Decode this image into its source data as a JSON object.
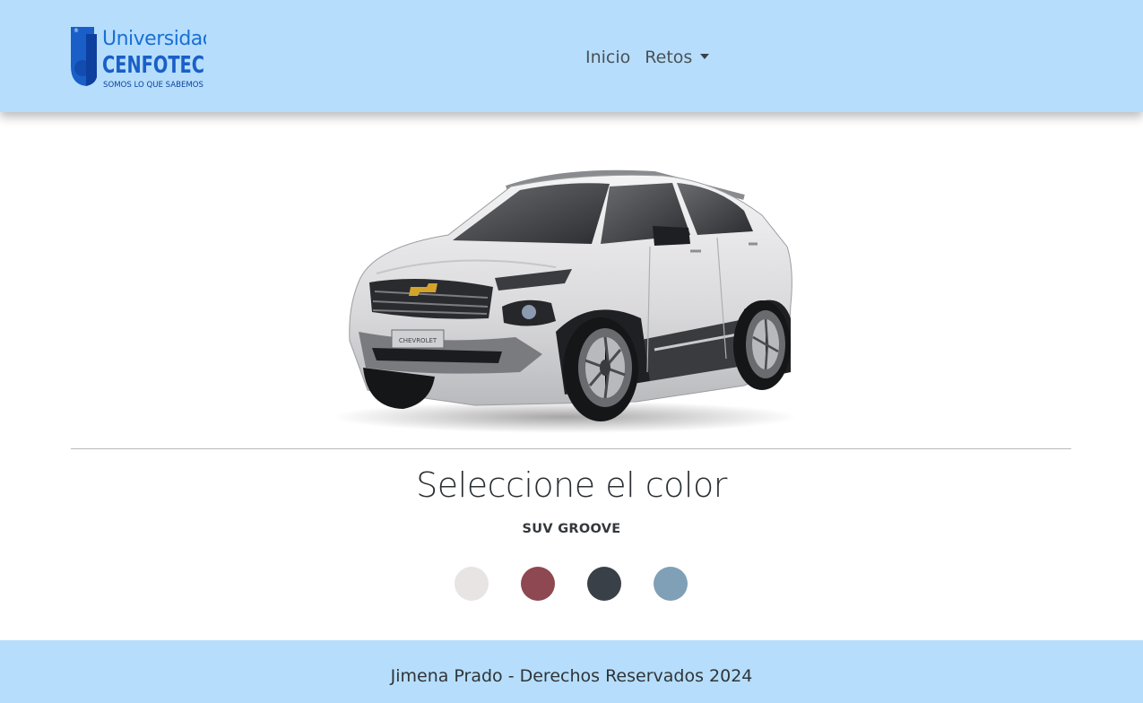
{
  "navbar": {
    "logo": {
      "line1": "Universidad",
      "line2": "CENFOTEC",
      "tagline": "SOMOS LO QUE SABEMOS",
      "mark": "®",
      "color": "#1a5fc8"
    },
    "links": [
      {
        "label": "Inicio"
      },
      {
        "label": "Retos",
        "has_dropdown": true
      }
    ],
    "background": "#b6defc"
  },
  "main": {
    "product_image": {
      "icon": "suv-car-image",
      "plate_text": "CHEVROLET"
    },
    "title": "Seleccione el color",
    "model": "SUV GROOVE",
    "colors": [
      {
        "name": "white-swatch",
        "hex": "#e8e4e3"
      },
      {
        "name": "red-swatch",
        "hex": "#8e4851"
      },
      {
        "name": "dark-swatch",
        "hex": "#3a4047"
      },
      {
        "name": "blue-swatch",
        "hex": "#7fa0b6"
      }
    ]
  },
  "footer": {
    "text": "Jimena Prado - Derechos Reservados 2024",
    "background": "#b6defc"
  }
}
